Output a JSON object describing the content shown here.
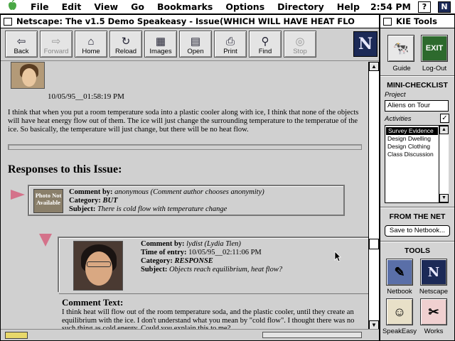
{
  "menubar": {
    "apple": "",
    "items": [
      "File",
      "Edit",
      "View",
      "Go",
      "Bookmarks",
      "Options",
      "Directory",
      "Help"
    ],
    "time": "2:54 PM",
    "help_glyph": "?",
    "app_glyph": "N"
  },
  "netscape": {
    "title": "Netscape: The v1.5 Demo Speakeasy - Issue(WHICH WILL HAVE HEAT FLO",
    "toolbar": [
      {
        "label": "Back",
        "icon": "⇦",
        "enabled": true
      },
      {
        "label": "Forward",
        "icon": "⇨",
        "enabled": false
      },
      {
        "label": "Home",
        "icon": "⌂",
        "enabled": true
      },
      {
        "label": "Reload",
        "icon": "↻",
        "enabled": true
      },
      {
        "label": "Images",
        "icon": "▦",
        "enabled": true
      },
      {
        "label": "Open",
        "icon": "▤",
        "enabled": true
      },
      {
        "label": "Print",
        "icon": "⎙",
        "enabled": true
      },
      {
        "label": "Find",
        "icon": "⚲",
        "enabled": true
      },
      {
        "label": "Stop",
        "icon": "◎",
        "enabled": false
      }
    ],
    "logo": "N"
  },
  "page": {
    "post_date": "10/05/95__01:58:19 PM",
    "post_text": "I think that when you put a room temperature soda into a plastic cooler along with ice, I think that none of the objects will have heat energy flow out of them. The ice will just change the surrounding temperature to the temperatue of the ice. So basically, the temperature will just change, but there will be no heat flow.",
    "responses_heading": "Responses to this Issue:",
    "response1": {
      "no_photo": "Photo Not Available",
      "comment_by_label": "Comment by:",
      "comment_by": "anonymous (Comment author chooses anonymity)",
      "category_label": "Category:",
      "category": "BUT",
      "subject_label": "Subject:",
      "subject": "There is cold flow with temperature change"
    },
    "response2": {
      "comment_by_label": "Comment by:",
      "comment_by": "lydist (Lydia Tien)",
      "time_label": "Time of entry:",
      "time": "10/05/95__02:11:06 PM",
      "category_label": "Category:",
      "category": "RESPONSE",
      "subject_label": "Subject:",
      "subject": "Objects reach equilibrium, heat flow?",
      "comment_text_label": "Comment Text:",
      "comment_text": "I think heat will flow out of the room temperature soda, and the plastic cooler, until they create an equilibrium with the ice. I don't understand what you mean by \"cold flow\". I thought there was no such thing as cold energy. Could you explain this to me?"
    }
  },
  "kie": {
    "title": "KIE Tools",
    "guide_label": "Guide",
    "logout_label": "Log-Out",
    "exit_text": "EXIT",
    "mini_checklist": "MINI-CHECKLIST",
    "project_label": "Project",
    "project_value": "Aliens on Tour",
    "activities_label": "Activities",
    "activities": [
      "Survey Evidence",
      "Design Dwelling",
      "Design Clothing",
      "Class Discussion"
    ],
    "from_net": "FROM THE NET",
    "save_button": "Save to Netbook...",
    "tools_heading": "TOOLS",
    "tools": [
      "Netbook",
      "Netscape",
      "SpeakEasy",
      "Works"
    ],
    "netscape_glyph": "N"
  }
}
